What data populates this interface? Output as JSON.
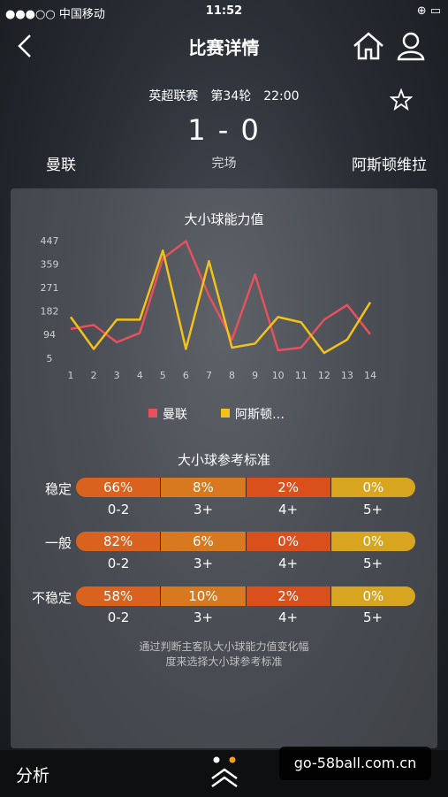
{
  "status_bar": {
    "carrier": "●●●○○ 中国移动",
    "time": "11:52",
    "battery": "⊕ ▭"
  },
  "nav": {
    "title": "比赛详情"
  },
  "match": {
    "league_round_time": "英超联赛　第34轮　22:00",
    "score": "1 - 0",
    "status": "完场",
    "home_team": "曼联",
    "away_team": "阿斯顿维拉"
  },
  "chart_title": "大小球能力值",
  "chart_data": {
    "type": "line",
    "x": [
      1,
      2,
      3,
      4,
      5,
      6,
      7,
      8,
      9,
      10,
      11,
      12,
      13,
      14
    ],
    "y_ticks": [
      447,
      359,
      271,
      182,
      94,
      5
    ],
    "ylim": [
      5,
      447
    ],
    "series": [
      {
        "name": "曼联",
        "color": "#e8505b",
        "values": [
          115,
          130,
          65,
          100,
          380,
          445,
          240,
          75,
          320,
          35,
          45,
          150,
          205,
          95
        ]
      },
      {
        "name": "阿斯顿…",
        "color": "#f2c21b",
        "values": [
          160,
          40,
          150,
          150,
          410,
          40,
          370,
          45,
          60,
          160,
          140,
          25,
          75,
          215
        ]
      }
    ],
    "grid": false
  },
  "reference": {
    "title": "大小球参考标准",
    "categories": [
      "0-2",
      "3+",
      "4+",
      "5+"
    ],
    "rows": [
      {
        "label": "稳定",
        "values": [
          "66%",
          "8%",
          "2%",
          "0%"
        ]
      },
      {
        "label": "一般",
        "values": [
          "82%",
          "6%",
          "0%",
          "0%"
        ]
      },
      {
        "label": "不稳定",
        "values": [
          "58%",
          "10%",
          "2%",
          "0%"
        ]
      }
    ],
    "note_line1": "通过判断主客队大小球能力值变化幅",
    "note_line2": "度来选择大小球参考标准"
  },
  "bottom": {
    "tab_label": "分析"
  },
  "watermark": "go-58ball.com.cn"
}
